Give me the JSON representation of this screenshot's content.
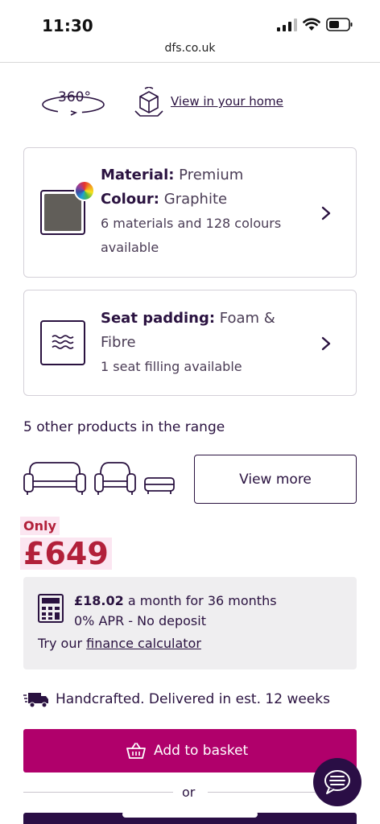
{
  "status_bar": {
    "time": "11:30"
  },
  "browser": {
    "url": "dfs.co.uk"
  },
  "viewer": {
    "rotate_label": "360°",
    "ar_link": "View in your home"
  },
  "material_card": {
    "material_label": "Material:",
    "material_value": "Premium",
    "colour_label": "Colour:",
    "colour_value": "Graphite",
    "options_text": "6 materials and 128 colours available",
    "swatch_color": "#615e59"
  },
  "padding_card": {
    "label": "Seat padding:",
    "value": "Foam & Fibre",
    "options_text": "1 seat filling available"
  },
  "range": {
    "title": "5 other products in the range",
    "view_more": "View more",
    "icons": [
      "sofa-icon",
      "armchair-icon",
      "footstool-icon"
    ]
  },
  "price": {
    "prefix": "Only",
    "amount": "£649",
    "color": "#b2203a"
  },
  "finance": {
    "monthly_amount": "£18.02",
    "monthly_text": "a month for 36 months",
    "apr_text": "0% APR - No deposit",
    "calculator_prefix": "Try our",
    "calculator_link": "finance calculator"
  },
  "delivery": {
    "text": "Handcrafted. Delivered in est. 12 weeks"
  },
  "actions": {
    "add_to_basket": "Add to basket",
    "or": "or",
    "basket_color": "#b0006b"
  }
}
